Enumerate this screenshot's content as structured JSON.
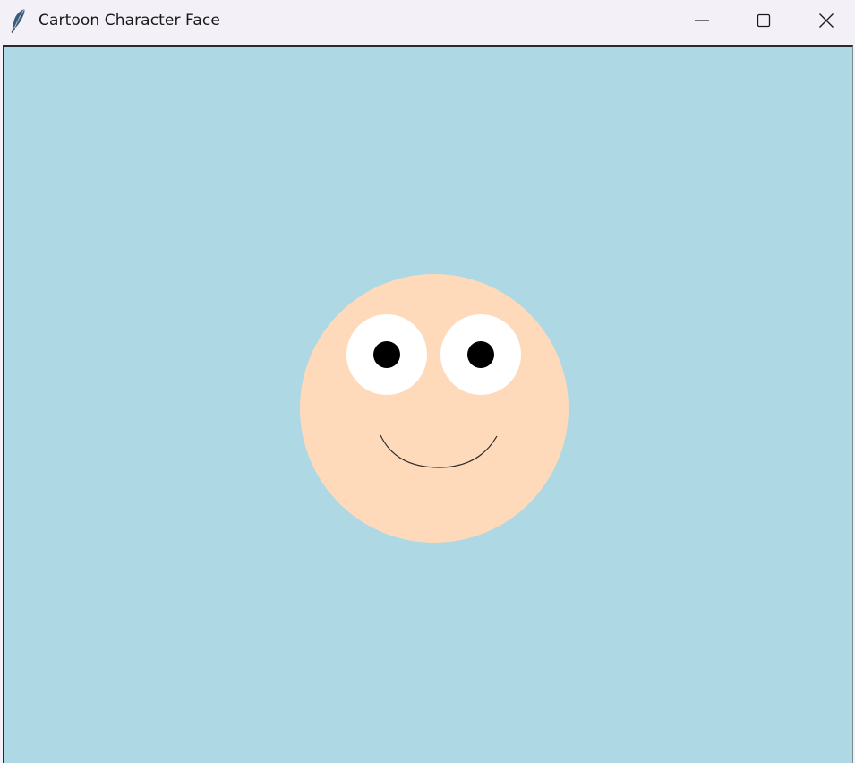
{
  "window": {
    "title": "Cartoon Character Face",
    "icon": "feather-icon",
    "controls": {
      "minimize_icon": "minimize-icon",
      "maximize_icon": "maximize-icon",
      "close_icon": "close-icon"
    }
  },
  "canvas": {
    "background_color": "#add8e4",
    "face": {
      "skin_color": "#fedabb",
      "eye_white_color": "#ffffff",
      "pupil_color": "#000000",
      "mouth_color": "#2a2a2a"
    }
  }
}
